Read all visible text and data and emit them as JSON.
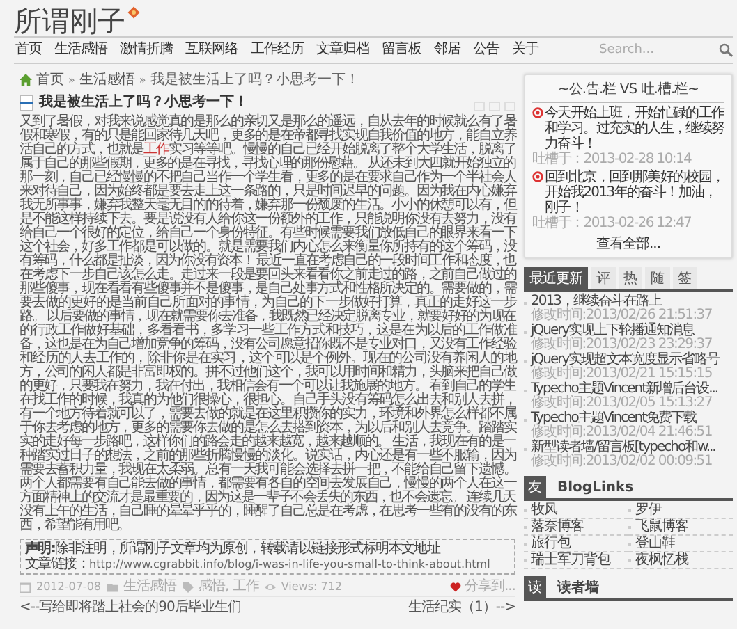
{
  "site": {
    "title": "所谓刚子"
  },
  "nav": {
    "items": [
      {
        "label": "首页",
        "selected": false
      },
      {
        "label": "生活感悟",
        "selected": false
      },
      {
        "label": "激情折腾",
        "selected": false
      },
      {
        "label": "互联网络",
        "selected": false
      },
      {
        "label": "工作经历",
        "selected": false
      },
      {
        "label": "文章归档",
        "selected": false
      },
      {
        "label": "留言板",
        "selected": false
      },
      {
        "label": "邻居",
        "selected": false
      },
      {
        "label": "公告",
        "selected": false
      },
      {
        "label": "关于",
        "selected": false
      }
    ],
    "search": {
      "placeholder": "Search..."
    }
  },
  "breadcrumb": {
    "separator": "»",
    "items": [
      "首页",
      "生活感悟",
      "我是被生活上了吗？小思考一下！"
    ]
  },
  "article": {
    "title": "我是被生活上了吗？小思考一下！",
    "paragraph": [
      {
        "kind": "text",
        "text": "又到了暑假，对我来说感觉真的是那么的亲切又是那么的遥远，自从去年的时候就么有了暑假和寒假，有的只是能回家待几天吧，更多的是在帝都寻找实现自我价值的地方，能自立养活自己的方式，也就是"
      },
      {
        "kind": "link",
        "text": "工作"
      },
      {
        "kind": "text",
        "text": "实习等等吧。慢慢的自己已经开始脱离了整个大学生活，脱离了属于自己的那些假期，更多的是在寻找，寻找心理的那份慰藉。 从还未到大四就开始独立的那一刻，自己已经慢慢的不把自己当作一个学生看，更多的是在要求自己作为一个半社会人来对待自己，因为始终都是要去走上这一条路的，只是时间迟早的问题。因为我在内心嫌弃我无所事事，嫌弃我整天毫无目的的待着，嫌弃那一份颓废的生活。小小的休憩可以有，但是不能这样持续下去。要是说没有人给你这一份额外的工作，只能说明你没有去努力，没有给自己一个很好的定位，给自己一个身份特征。有些时候需要我们放低自己的眼界来看一下这个社会，好多工作都是可以做的。就是需要我们内心怎么来衡量你所持有的这个筹码，没有筹码，什么都是扯淡，因为你没有资本！ 最近一直在考虑自己的一段时间工作和态度，也在考虑下一步自己该怎么走。走过来一段是要回头来看看你之前走过的路，之前自己做过的那些傻事，现在看看有些傻事并不是傻事，是自己处事方式和性格所决定的。需要做的，需要去做的更好的是当前自己所面对的事情，为自己的下一步做好打算，真正的走好这一步路。 以后要做的事情，现在就需要你去准备，我既然已经决定脱离专业，就要好好的为现在的行政工作做好基础，多看看书，多学习一些工作方式和技巧，这是在为以后的工作做准备，这也是在为自己增加竞争的筹码，没有公司愿意招你既不是专业对口，又没有工作经验和经历的人去工作的，除非你是在实习，这个可以是个例外。现在的公司没有养闲人的地方，公司的闲人都是非富即权的。拼不过他们这个，我可以用时间和精力，头脑来把自己做的更好，只要我在努力，我在付出，我相信会有一个可以让我施展的地方。 看到自己的学生在找工作的时候，我真的为他们很操心，很担心。自己手头没有筹码怎么出去和别人去拼，有一个地方待着就可以了，需要去做的就是在这里积攒你的实力，环境和外界怎么样都不属于你去考虑的地方，更多的需要你去做的是怎么去搭到资本，为以后和别人去竞争。踏踏实实的走好每一步路吧，这样你们的路会走的越来越宽，越来越顺的。 生活，我现在有的是一种踏实过日子的想法，之前的那些折腾慢慢的淡化。说实话，内心还是有一些不服输，因为需要去蓄积力量，我现在太柔弱。总有一天我可能会选择去拼一把，不能给自己留下遗憾。两个人都需要有自己能去做的事情，都需要有各自的空间去发展自己，慢慢的两个人在这一方面精神上的交流才是最重要的，因为这是一辈子不会丢失的东西，也不会遗忘。 连续几天没有上午的生活，自己睡的晕晕乎乎的，睡醒了自己总是在考虑，在思考一些有的没有的东西，希望能有用吧。"
      }
    ],
    "notice": {
      "statement": "**声明:**除非注明，所谓刚子文章均为原创，转载请以链接形式标明本文地址",
      "link_label": "文章链接：",
      "link": "http://www.cgrabbit.info/blog/i-was-in-life-you-small-to-think-about.html"
    },
    "meta": {
      "date": "2012-07-08",
      "category": "生活感悟",
      "tags": "感悟, 工作",
      "views": "Views: 712",
      "share": "分享到..."
    },
    "prev": "<--写给即将踏上社会的90后毕业生们",
    "next": "生活纪实（1）-->"
  },
  "sidebar": {
    "announcements": {
      "title": "~公.告.栏 VS 吐.槽.栏~",
      "entries": [
        {
          "text": "今天开始上班，开始忙碌的工作和学习。过充实的人生，继续努力奋斗！",
          "time": "吐槽于：2013-02-28 10:14"
        },
        {
          "text": "回到北京，回到那美好的校园，开始我2013年的奋斗！加油，刚子！",
          "time": "吐槽于：2013-02-26 12:47"
        }
      ],
      "more": "查看全部..."
    },
    "tabs": [
      {
        "label": "最近更新",
        "selected": true
      },
      {
        "label": "评",
        "selected": false
      },
      {
        "label": "热",
        "selected": false
      },
      {
        "label": "随",
        "selected": false
      },
      {
        "label": "签",
        "selected": false
      }
    ],
    "recent": [
      {
        "title": "2013，继续奋斗在路上",
        "time": "修改时间:2013/02/26 21:51:37"
      },
      {
        "title": "jQuery实现上下轮播通知消息",
        "time": "修改时间:2013/02/23 23:29:37"
      },
      {
        "title": "jQuery实现超文本宽度显示省略号",
        "time": "修改时间:2013/02/21 15:15:15"
      },
      {
        "title": "Typecho主题Vincent新增后台设...",
        "time": "修改时间:2013/02/05 15:13:27"
      },
      {
        "title": "Typecho主题Vincent免费下载",
        "time": "修改时间:2013/02/04 21:46:51"
      },
      {
        "title": "新型读者墙/留言板[typecho和w...",
        "time": "修改时间:2013/02/02 00:09:51"
      }
    ],
    "blog_links": {
      "badge": "友",
      "title": "BlogLinks",
      "links": [
        "牧风",
        "罗伊",
        "落奈博客",
        "飞鼠博客",
        "旅行包",
        "登山鞋",
        "瑞士军刀背包",
        "夜枫忆栈"
      ]
    },
    "readers": {
      "badge": "读",
      "title": "读者墙"
    }
  }
}
